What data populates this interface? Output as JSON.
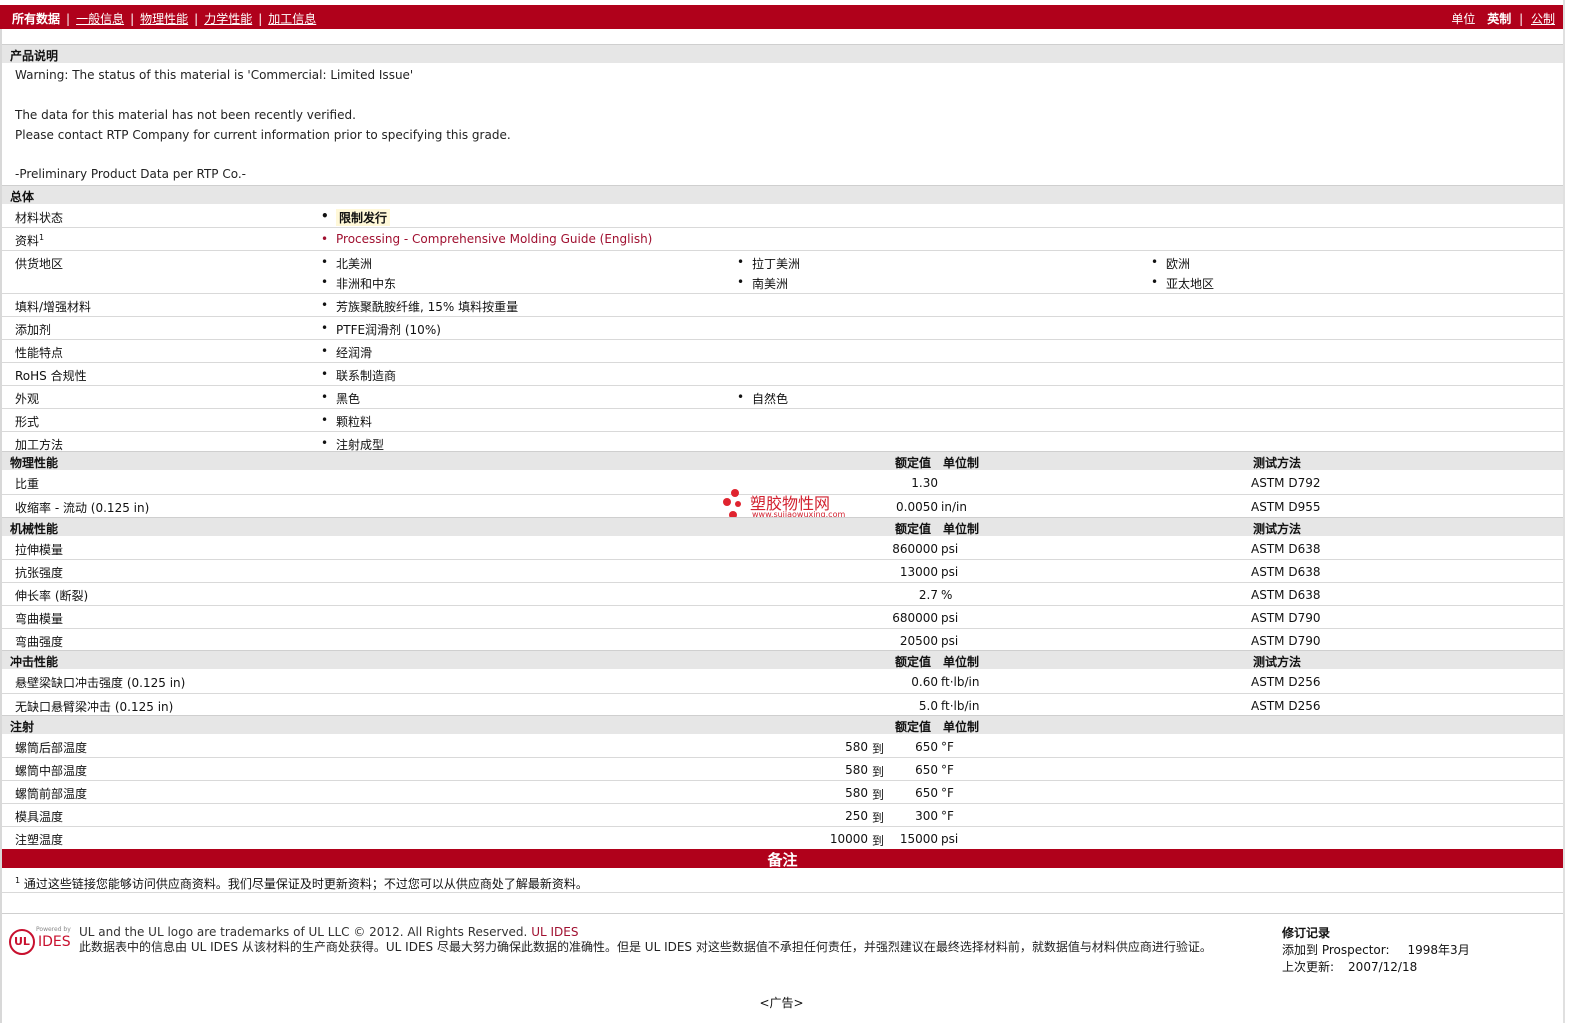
{
  "nav": {
    "all_data": "所有数据",
    "general": "一般信息",
    "physical": "物理性能",
    "mechanical": "力学性能",
    "processing": "加工信息",
    "units_label": "单位",
    "english": "英制",
    "metric": "公制"
  },
  "product_desc": {
    "title": "产品说明",
    "lines": [
      "Warning: The status of this material is 'Commercial: Limited Issue'",
      "The data for this material has not been recently verified.",
      "Please contact RTP Company for current information prior to specifying this grade.",
      "-Preliminary Product Data per RTP Co.-"
    ]
  },
  "general": {
    "title": "总体",
    "rows": [
      {
        "label": "材料状态",
        "values": [
          "限制发行"
        ]
      },
      {
        "label": "资料",
        "sup": "1",
        "values": [
          "Processing - Comprehensive Molding Guide (English)"
        ]
      },
      {
        "label": "供货地区",
        "values": [
          "北美洲",
          "拉丁美洲",
          "欧洲",
          "非洲和中东",
          "南美洲",
          "亚太地区"
        ]
      },
      {
        "label": "填料/增强材料",
        "values": [
          "芳族聚酰胺纤维, 15% 填料按重量"
        ]
      },
      {
        "label": "添加剂",
        "values": [
          "PTFE润滑剂 (10%)"
        ]
      },
      {
        "label": "性能特点",
        "values": [
          "经润滑"
        ]
      },
      {
        "label": "RoHS 合规性",
        "values": [
          "联系制造商"
        ]
      },
      {
        "label": "外观",
        "values": [
          "黑色",
          "自然色"
        ]
      },
      {
        "label": "形式",
        "values": [
          "颗粒料"
        ]
      },
      {
        "label": "加工方法",
        "values": [
          "注射成型"
        ]
      }
    ]
  },
  "headers": {
    "nominal": "额定值",
    "units": "单位制",
    "method": "测试方法"
  },
  "physical": {
    "title": "物理性能",
    "rows": [
      {
        "label": "比重",
        "value": "1.30",
        "unit": "",
        "method": "ASTM D792"
      },
      {
        "label": "收缩率 - 流动",
        "cond": "(0.125 in)",
        "value": "0.0050",
        "unit": "in/in",
        "method": "ASTM D955"
      }
    ]
  },
  "mechanical": {
    "title": "机械性能",
    "rows": [
      {
        "label": "拉伸模量",
        "value": "860000",
        "unit": "psi",
        "method": "ASTM D638"
      },
      {
        "label": "抗张强度",
        "value": "13000",
        "unit": "psi",
        "method": "ASTM D638"
      },
      {
        "label": "伸长率 (断裂)",
        "value": "2.7",
        "unit": "%",
        "method": "ASTM D638"
      },
      {
        "label": "弯曲模量",
        "value": "680000",
        "unit": "psi",
        "method": "ASTM D790"
      },
      {
        "label": "弯曲强度",
        "value": "20500",
        "unit": "psi",
        "method": "ASTM D790"
      }
    ]
  },
  "impact": {
    "title": "冲击性能",
    "rows": [
      {
        "label": "悬壁梁缺口冲击强度",
        "cond": "(0.125 in)",
        "value": "0.60",
        "unit": "ft·lb/in",
        "method": "ASTM D256"
      },
      {
        "label": "无缺口悬臂梁冲击",
        "cond": "(0.125 in)",
        "value": "5.0",
        "unit": "ft·lb/in",
        "method": "ASTM D256"
      }
    ]
  },
  "injection": {
    "title": "注射",
    "to": "到",
    "rows": [
      {
        "label": "螺筒后部温度",
        "low": "580",
        "high": "650",
        "unit": "°F"
      },
      {
        "label": "螺筒中部温度",
        "low": "580",
        "high": "650",
        "unit": "°F"
      },
      {
        "label": "螺筒前部温度",
        "low": "580",
        "high": "650",
        "unit": "°F"
      },
      {
        "label": "模具温度",
        "low": "250",
        "high": "300",
        "unit": "°F"
      },
      {
        "label": "注塑温度",
        "low": "10000",
        "high": "15000",
        "unit": "psi"
      }
    ]
  },
  "notes": {
    "title": "备注",
    "sup": "1",
    "text": "通过这些链接您能够访问供应商资料。我们尽量保证及时更新资料；不过您可以从供应商处了解最新资料。"
  },
  "watermark": {
    "cn": "塑胶物性网",
    "url": "www.sujiaowuxing.com"
  },
  "footer": {
    "logo_powered": "Powered by",
    "logo_ul": "UL",
    "logo_ides": "IDES",
    "trademark": "UL and the UL logo are trademarks of UL LLC © 2012. All Rights Reserved.",
    "trademark_link": "UL IDES",
    "disclaimer": "此数据表中的信息由 UL IDES 从该材料的生产商处获得。UL IDES 尽最大努力确保此数据的准确性。但是 UL IDES 对这些数据值不承担任何责任，并强烈建议在最终选择材料前，就数据值与材料供应商进行验证。",
    "rev_title": "修订记录",
    "added_label": "添加到 Prospector:",
    "added_value": "1998年3月",
    "updated_label": "上次更新:",
    "updated_value": "2007/12/18"
  },
  "ad": "<广告>",
  "colors": {
    "brand_red": "#b0011b",
    "link_red": "#a01030",
    "section_gray": "#e6e6e6"
  }
}
